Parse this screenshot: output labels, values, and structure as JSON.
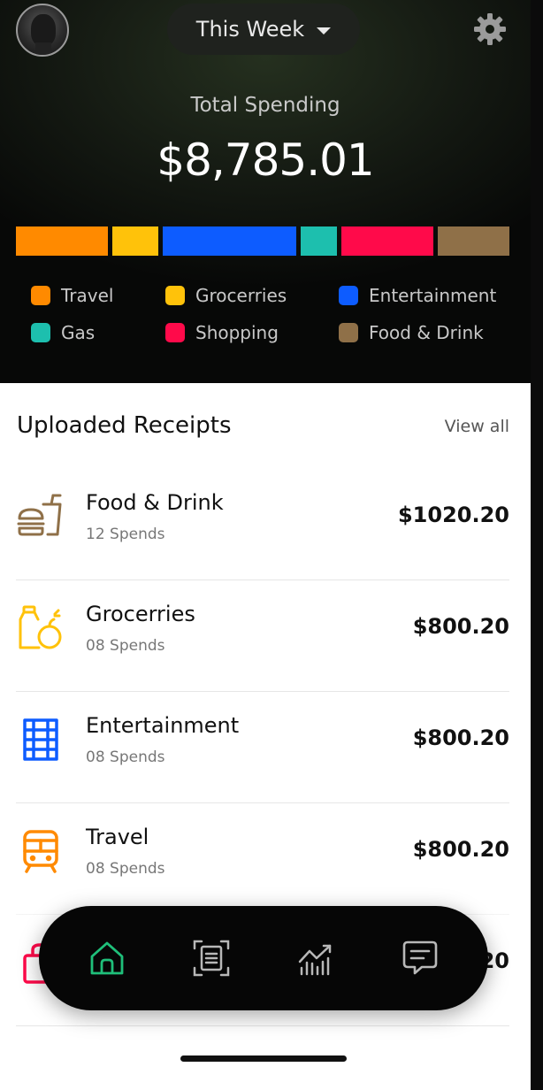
{
  "header": {
    "period_label": "This Week",
    "total_label": "Total Spending",
    "total_value": "$8,785.01"
  },
  "spending_bar": [
    {
      "category": "Travel",
      "color": "#ff8a00",
      "share": 0.18
    },
    {
      "category": "Grocerries",
      "color": "#ffc20a",
      "share": 0.09
    },
    {
      "category": "Entertainment",
      "color": "#0d5cff",
      "share": 0.26
    },
    {
      "category": "Gas",
      "color": "#1dbfae",
      "share": 0.07
    },
    {
      "category": "Shopping",
      "color": "#ff0a4a",
      "share": 0.18
    },
    {
      "category": "Food & Drink",
      "color": "#8f7048",
      "share": 0.14
    }
  ],
  "legend": [
    {
      "label": "Travel",
      "color": "#ff8a00"
    },
    {
      "label": "Grocerries",
      "color": "#ffc20a"
    },
    {
      "label": "Entertainment",
      "color": "#0d5cff"
    },
    {
      "label": "Gas",
      "color": "#1dbfae"
    },
    {
      "label": "Shopping",
      "color": "#ff0a4a"
    },
    {
      "label": "Food &  Drink",
      "color": "#8f7048"
    }
  ],
  "receipts": {
    "title": "Uploaded Receipts",
    "view_all": "View all",
    "items": [
      {
        "name": "Food & Drink",
        "spends": "12 Spends",
        "amount": "$1020.20",
        "icon": "food-drink-icon",
        "color": "#8f7048"
      },
      {
        "name": "Grocerries",
        "spends": "08 Spends",
        "amount": "$800.20",
        "icon": "groceries-icon",
        "color": "#ffc20a"
      },
      {
        "name": "Entertainment",
        "spends": "08 Spends",
        "amount": "$800.20",
        "icon": "film-icon",
        "color": "#0d5cff"
      },
      {
        "name": "Travel",
        "spends": "08 Spends",
        "amount": "$800.20",
        "icon": "train-icon",
        "color": "#ff8a00"
      },
      {
        "name": "",
        "spends": "",
        "amount": "20",
        "icon": "shopping-bag-icon",
        "color": "#ff0a4a"
      }
    ]
  },
  "nav": {
    "items": [
      {
        "icon": "home-icon",
        "active": true
      },
      {
        "icon": "scan-receipt-icon",
        "active": false
      },
      {
        "icon": "analytics-icon",
        "active": false
      },
      {
        "icon": "chat-icon",
        "active": false
      }
    ],
    "active_color": "#1fbf7a"
  }
}
